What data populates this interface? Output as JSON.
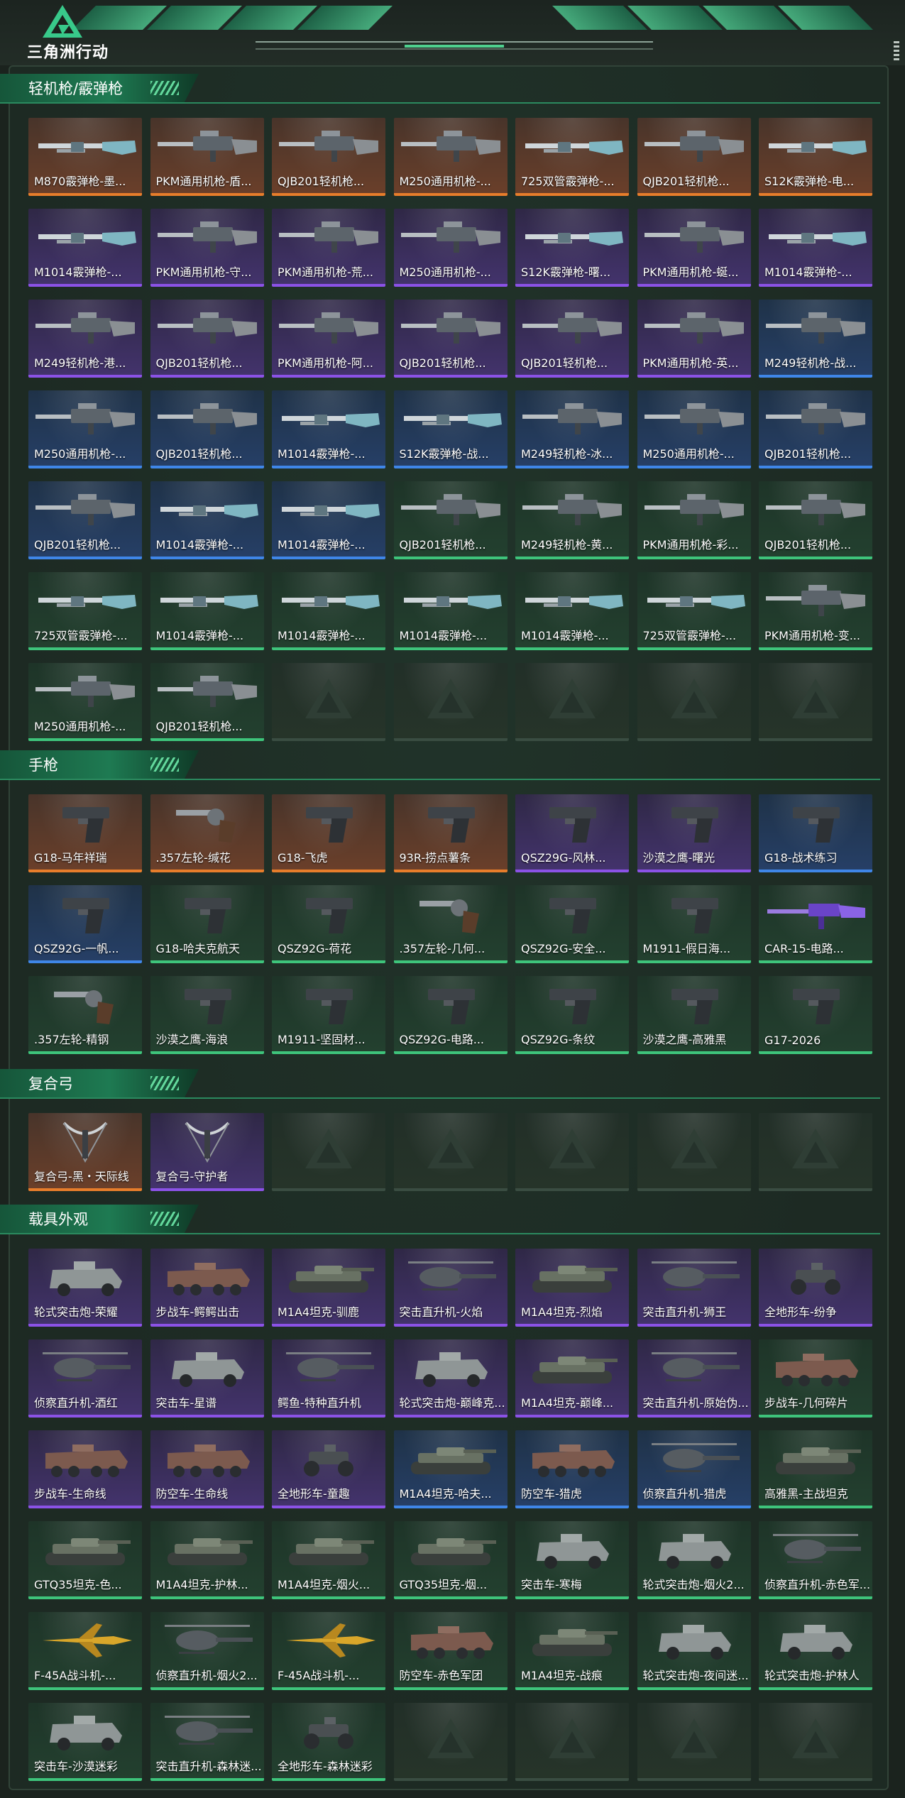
{
  "header": {
    "logo_text": "三角洲行动"
  },
  "sections": [
    {
      "title": "轻机枪/霰弹枪",
      "items": [
        {
          "label": "M870霰弹枪-墨...",
          "rarity": "orange",
          "icon": "shotgun-icon"
        },
        {
          "label": "PKM通用机枪-盾...",
          "rarity": "orange",
          "icon": "machine-gun-icon"
        },
        {
          "label": "QJB201轻机枪...",
          "rarity": "orange",
          "icon": "machine-gun-icon"
        },
        {
          "label": "M250通用机枪-...",
          "rarity": "orange",
          "icon": "machine-gun-icon"
        },
        {
          "label": "725双管霰弹枪-...",
          "rarity": "orange",
          "icon": "shotgun-icon"
        },
        {
          "label": "QJB201轻机枪...",
          "rarity": "orange",
          "icon": "machine-gun-icon"
        },
        {
          "label": "S12K霰弹枪-电...",
          "rarity": "orange",
          "icon": "shotgun-icon"
        },
        {
          "label": "M1014霰弹枪-...",
          "rarity": "purple",
          "icon": "shotgun-icon"
        },
        {
          "label": "PKM通用机枪-守...",
          "rarity": "purple",
          "icon": "machine-gun-icon"
        },
        {
          "label": "PKM通用机枪-荒...",
          "rarity": "purple",
          "icon": "machine-gun-icon"
        },
        {
          "label": "M250通用机枪-...",
          "rarity": "purple",
          "icon": "machine-gun-icon"
        },
        {
          "label": "S12K霰弹枪-曙...",
          "rarity": "purple",
          "icon": "shotgun-icon"
        },
        {
          "label": "PKM通用机枪-蜒...",
          "rarity": "purple",
          "icon": "machine-gun-icon"
        },
        {
          "label": "M1014霰弹枪-...",
          "rarity": "purple",
          "icon": "shotgun-icon"
        },
        {
          "label": "M249轻机枪-港...",
          "rarity": "purple",
          "icon": "machine-gun-icon"
        },
        {
          "label": "QJB201轻机枪...",
          "rarity": "purple",
          "icon": "machine-gun-icon"
        },
        {
          "label": "PKM通用机枪-阿...",
          "rarity": "purple",
          "icon": "machine-gun-icon"
        },
        {
          "label": "QJB201轻机枪...",
          "rarity": "purple",
          "icon": "machine-gun-icon"
        },
        {
          "label": "QJB201轻机枪...",
          "rarity": "purple",
          "icon": "machine-gun-icon"
        },
        {
          "label": "PKM通用机枪-英...",
          "rarity": "purple",
          "icon": "machine-gun-icon"
        },
        {
          "label": "M249轻机枪-战...",
          "rarity": "blue",
          "icon": "machine-gun-icon"
        },
        {
          "label": "M250通用机枪-...",
          "rarity": "blue",
          "icon": "machine-gun-icon"
        },
        {
          "label": "QJB201轻机枪...",
          "rarity": "blue",
          "icon": "machine-gun-icon"
        },
        {
          "label": "M1014霰弹枪-...",
          "rarity": "blue",
          "icon": "shotgun-icon"
        },
        {
          "label": "S12K霰弹枪-战...",
          "rarity": "blue",
          "icon": "shotgun-icon"
        },
        {
          "label": "M249轻机枪-冰...",
          "rarity": "blue",
          "icon": "machine-gun-icon"
        },
        {
          "label": "M250通用机枪-...",
          "rarity": "blue",
          "icon": "machine-gun-icon"
        },
        {
          "label": "QJB201轻机枪...",
          "rarity": "blue",
          "icon": "machine-gun-icon"
        },
        {
          "label": "QJB201轻机枪...",
          "rarity": "blue",
          "icon": "machine-gun-icon"
        },
        {
          "label": "M1014霰弹枪-...",
          "rarity": "blue",
          "icon": "shotgun-icon"
        },
        {
          "label": "M1014霰弹枪-...",
          "rarity": "blue",
          "icon": "shotgun-icon"
        },
        {
          "label": "QJB201轻机枪...",
          "rarity": "green",
          "icon": "machine-gun-icon"
        },
        {
          "label": "M249轻机枪-黄...",
          "rarity": "green",
          "icon": "machine-gun-icon"
        },
        {
          "label": "PKM通用机枪-彩...",
          "rarity": "green",
          "icon": "machine-gun-icon"
        },
        {
          "label": "QJB201轻机枪...",
          "rarity": "green",
          "icon": "machine-gun-icon"
        },
        {
          "label": "725双管霰弹枪-...",
          "rarity": "green",
          "icon": "shotgun-icon"
        },
        {
          "label": "M1014霰弹枪-...",
          "rarity": "green",
          "icon": "shotgun-icon"
        },
        {
          "label": "M1014霰弹枪-...",
          "rarity": "green",
          "icon": "shotgun-icon"
        },
        {
          "label": "M1014霰弹枪-...",
          "rarity": "green",
          "icon": "shotgun-icon"
        },
        {
          "label": "M1014霰弹枪-...",
          "rarity": "green",
          "icon": "shotgun-icon"
        },
        {
          "label": "725双管霰弹枪-...",
          "rarity": "green",
          "icon": "shotgun-icon"
        },
        {
          "label": "PKM通用机枪-变...",
          "rarity": "green",
          "icon": "machine-gun-icon"
        },
        {
          "label": "M250通用机枪-...",
          "rarity": "green",
          "icon": "machine-gun-icon"
        },
        {
          "label": "QJB201轻机枪...",
          "rarity": "green",
          "icon": "machine-gun-icon"
        },
        {
          "label": "",
          "rarity": "empty",
          "icon": "empty-slot-icon"
        },
        {
          "label": "",
          "rarity": "empty",
          "icon": "empty-slot-icon"
        },
        {
          "label": "",
          "rarity": "empty",
          "icon": "empty-slot-icon"
        },
        {
          "label": "",
          "rarity": "empty",
          "icon": "empty-slot-icon"
        },
        {
          "label": "",
          "rarity": "empty",
          "icon": "empty-slot-icon"
        }
      ]
    },
    {
      "title": "手枪",
      "items": [
        {
          "label": "G18-马年祥瑞",
          "rarity": "orange",
          "icon": "pistol-icon"
        },
        {
          "label": ".357左轮-缄花",
          "rarity": "orange",
          "icon": "revolver-icon"
        },
        {
          "label": "G18-飞虎",
          "rarity": "orange",
          "icon": "pistol-icon"
        },
        {
          "label": "93R-捞点薯条",
          "rarity": "orange",
          "icon": "pistol-icon"
        },
        {
          "label": "QSZ29G-风林...",
          "rarity": "purple",
          "icon": "pistol-icon"
        },
        {
          "label": "沙漠之鹰-曙光",
          "rarity": "purple",
          "icon": "pistol-icon"
        },
        {
          "label": "G18-战术练习",
          "rarity": "blue",
          "icon": "pistol-icon"
        },
        {
          "label": "QSZ92G-一帆...",
          "rarity": "blue",
          "icon": "pistol-icon"
        },
        {
          "label": "G18-哈夫克航天",
          "rarity": "green",
          "icon": "pistol-icon"
        },
        {
          "label": "QSZ92G-荷花",
          "rarity": "green",
          "icon": "pistol-icon"
        },
        {
          "label": ".357左轮-几何...",
          "rarity": "green",
          "icon": "revolver-icon"
        },
        {
          "label": "QSZ92G-安全...",
          "rarity": "green",
          "icon": "pistol-icon"
        },
        {
          "label": "M1911-假日海...",
          "rarity": "green",
          "icon": "pistol-icon"
        },
        {
          "label": "CAR-15-电路...",
          "rarity": "green",
          "icon": "rifle-icon"
        },
        {
          "label": ".357左轮-精钢",
          "rarity": "green",
          "icon": "revolver-icon"
        },
        {
          "label": "沙漠之鹰-海浪",
          "rarity": "green",
          "icon": "pistol-icon"
        },
        {
          "label": "M1911-坚固材...",
          "rarity": "green",
          "icon": "pistol-icon"
        },
        {
          "label": "QSZ92G-电路...",
          "rarity": "green",
          "icon": "pistol-icon"
        },
        {
          "label": "QSZ92G-条纹",
          "rarity": "green",
          "icon": "pistol-icon"
        },
        {
          "label": "沙漠之鹰-高雅黑",
          "rarity": "green",
          "icon": "pistol-icon"
        },
        {
          "label": "G17-2026",
          "rarity": "green",
          "icon": "pistol-icon"
        }
      ]
    },
    {
      "title": "复合弓",
      "items": [
        {
          "label": "复合弓-黑・天际线",
          "rarity": "orange",
          "icon": "bow-icon"
        },
        {
          "label": "复合弓-守护者",
          "rarity": "purple",
          "icon": "bow-icon"
        },
        {
          "label": "",
          "rarity": "empty",
          "icon": "empty-slot-icon"
        },
        {
          "label": "",
          "rarity": "empty",
          "icon": "empty-slot-icon"
        },
        {
          "label": "",
          "rarity": "empty",
          "icon": "empty-slot-icon"
        },
        {
          "label": "",
          "rarity": "empty",
          "icon": "empty-slot-icon"
        },
        {
          "label": "",
          "rarity": "empty",
          "icon": "empty-slot-icon"
        }
      ]
    },
    {
      "title": "载具外观",
      "items": [
        {
          "label": "轮式突击炮-荣耀",
          "rarity": "purple",
          "icon": "armored-car-icon"
        },
        {
          "label": "步战车-鳄鳄出击",
          "rarity": "purple",
          "icon": "apc-icon"
        },
        {
          "label": "M1A4坦克-驯鹿",
          "rarity": "purple",
          "icon": "tank-icon"
        },
        {
          "label": "突击直升机-火焰",
          "rarity": "purple",
          "icon": "helicopter-icon"
        },
        {
          "label": "M1A4坦克-烈焰",
          "rarity": "purple",
          "icon": "tank-icon"
        },
        {
          "label": "突击直升机-狮王",
          "rarity": "purple",
          "icon": "helicopter-icon"
        },
        {
          "label": "全地形车-纷争",
          "rarity": "purple",
          "icon": "atv-icon"
        },
        {
          "label": "侦察直升机-酒红",
          "rarity": "purple",
          "icon": "helicopter-icon"
        },
        {
          "label": "突击车-星谱",
          "rarity": "purple",
          "icon": "armored-car-icon"
        },
        {
          "label": "鳄鱼-特种直升机",
          "rarity": "purple",
          "icon": "helicopter-icon"
        },
        {
          "label": "轮式突击炮-巅峰克...",
          "rarity": "purple",
          "icon": "armored-car-icon"
        },
        {
          "label": "M1A4坦克-巅峰...",
          "rarity": "purple",
          "icon": "tank-icon"
        },
        {
          "label": "突击直升机-原始伪...",
          "rarity": "purple",
          "icon": "helicopter-icon"
        },
        {
          "label": "步战车-几何碎片",
          "rarity": "green",
          "icon": "apc-icon"
        },
        {
          "label": "步战车-生命线",
          "rarity": "purple",
          "icon": "apc-icon"
        },
        {
          "label": "防空车-生命线",
          "rarity": "purple",
          "icon": "apc-icon"
        },
        {
          "label": "全地形车-童趣",
          "rarity": "purple",
          "icon": "atv-icon"
        },
        {
          "label": "M1A4坦克-哈夫...",
          "rarity": "blue",
          "icon": "tank-icon"
        },
        {
          "label": "防空车-猎虎",
          "rarity": "blue",
          "icon": "apc-icon"
        },
        {
          "label": "侦察直升机-猎虎",
          "rarity": "blue",
          "icon": "helicopter-icon"
        },
        {
          "label": "高雅黑-主战坦克",
          "rarity": "green",
          "icon": "tank-icon"
        },
        {
          "label": "GTQ35坦克-色...",
          "rarity": "green",
          "icon": "tank-icon"
        },
        {
          "label": "M1A4坦克-护林...",
          "rarity": "green",
          "icon": "tank-icon"
        },
        {
          "label": "M1A4坦克-烟火...",
          "rarity": "green",
          "icon": "tank-icon"
        },
        {
          "label": "GTQ35坦克-烟...",
          "rarity": "green",
          "icon": "tank-icon"
        },
        {
          "label": "突击车-寒梅",
          "rarity": "green",
          "icon": "armored-car-icon"
        },
        {
          "label": "轮式突击炮-烟火2...",
          "rarity": "green",
          "icon": "armored-car-icon"
        },
        {
          "label": "侦察直升机-赤色军...",
          "rarity": "green",
          "icon": "helicopter-icon"
        },
        {
          "label": "F-45A战斗机-...",
          "rarity": "green",
          "icon": "jet-icon"
        },
        {
          "label": "侦察直升机-烟火2...",
          "rarity": "green",
          "icon": "helicopter-icon"
        },
        {
          "label": "F-45A战斗机-...",
          "rarity": "green",
          "icon": "jet-icon"
        },
        {
          "label": "防空车-赤色军团",
          "rarity": "green",
          "icon": "apc-icon"
        },
        {
          "label": "M1A4坦克-战痕",
          "rarity": "green",
          "icon": "tank-icon"
        },
        {
          "label": "轮式突击炮-夜间迷...",
          "rarity": "green",
          "icon": "armored-car-icon"
        },
        {
          "label": "轮式突击炮-护林人",
          "rarity": "green",
          "icon": "armored-car-icon"
        },
        {
          "label": "突击车-沙漠迷彩",
          "rarity": "green",
          "icon": "armored-car-icon"
        },
        {
          "label": "突击直升机-森林迷...",
          "rarity": "green",
          "icon": "helicopter-icon"
        },
        {
          "label": "全地形车-森林迷彩",
          "rarity": "green",
          "icon": "atv-icon"
        },
        {
          "label": "",
          "rarity": "empty",
          "icon": "empty-slot-icon"
        },
        {
          "label": "",
          "rarity": "empty",
          "icon": "empty-slot-icon"
        },
        {
          "label": "",
          "rarity": "empty",
          "icon": "empty-slot-icon"
        },
        {
          "label": "",
          "rarity": "empty",
          "icon": "empty-slot-icon"
        }
      ]
    }
  ]
}
